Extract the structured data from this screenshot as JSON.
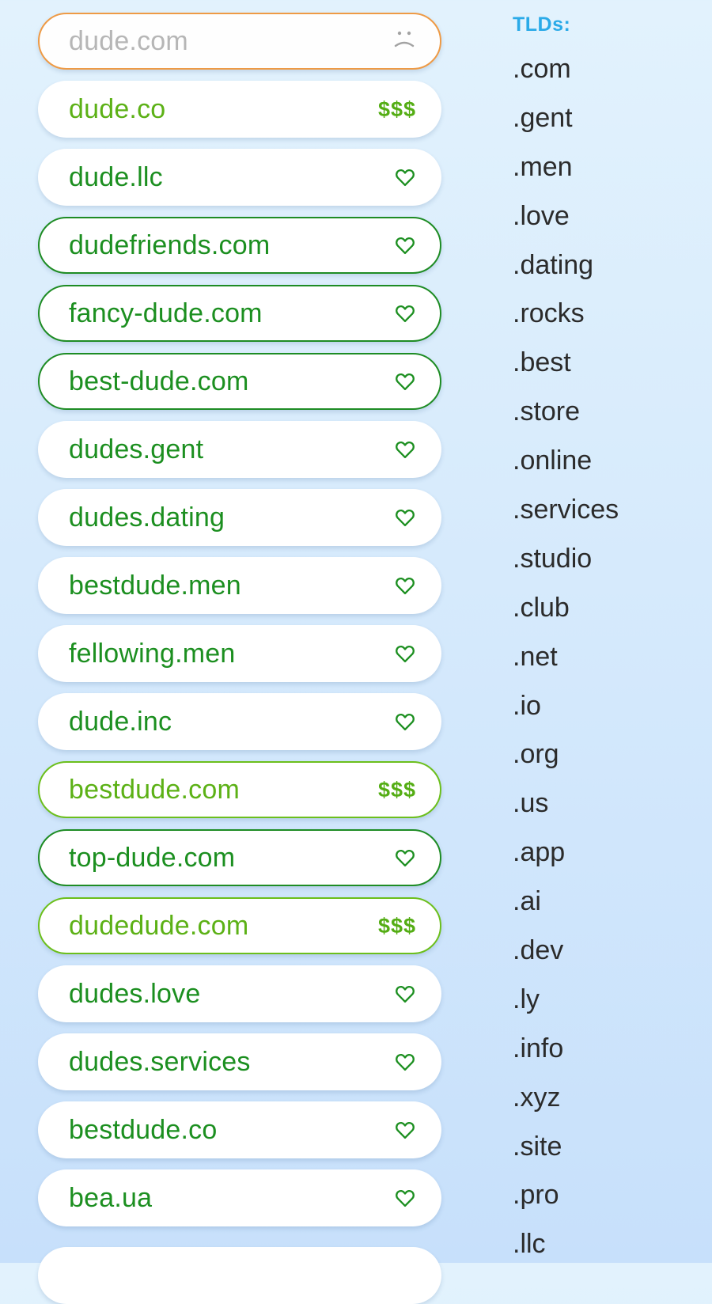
{
  "domains": [
    {
      "name": "dude.com",
      "status": "taken",
      "indicator": "˙͡˙",
      "style": "outlined-orange",
      "tone": "gray"
    },
    {
      "name": "dude.co",
      "status": "premium",
      "indicator": "$$$",
      "style": "plain",
      "tone": "light"
    },
    {
      "name": "dude.llc",
      "status": "available",
      "indicator": "heart",
      "style": "plain",
      "tone": "dark"
    },
    {
      "name": "dudefriends.com",
      "status": "available",
      "indicator": "heart",
      "style": "outlined-dark",
      "tone": "dark"
    },
    {
      "name": "fancy-dude.com",
      "status": "available",
      "indicator": "heart",
      "style": "outlined-dark",
      "tone": "dark"
    },
    {
      "name": "best-dude.com",
      "status": "available",
      "indicator": "heart",
      "style": "outlined-dark",
      "tone": "dark"
    },
    {
      "name": "dudes.gent",
      "status": "available",
      "indicator": "heart",
      "style": "plain",
      "tone": "dark"
    },
    {
      "name": "dudes.dating",
      "status": "available",
      "indicator": "heart",
      "style": "plain",
      "tone": "dark"
    },
    {
      "name": "bestdude.men",
      "status": "available",
      "indicator": "heart",
      "style": "plain",
      "tone": "dark"
    },
    {
      "name": "fellowing.men",
      "status": "available",
      "indicator": "heart",
      "style": "plain",
      "tone": "dark"
    },
    {
      "name": "dude.inc",
      "status": "available",
      "indicator": "heart",
      "style": "plain",
      "tone": "dark"
    },
    {
      "name": "bestdude.com",
      "status": "premium",
      "indicator": "$$$",
      "style": "outlined-light",
      "tone": "light"
    },
    {
      "name": "top-dude.com",
      "status": "available",
      "indicator": "heart",
      "style": "outlined-dark",
      "tone": "dark"
    },
    {
      "name": "dudedude.com",
      "status": "premium",
      "indicator": "$$$",
      "style": "outlined-light",
      "tone": "light"
    },
    {
      "name": "dudes.love",
      "status": "available",
      "indicator": "heart",
      "style": "plain",
      "tone": "dark"
    },
    {
      "name": "dudes.services",
      "status": "available",
      "indicator": "heart",
      "style": "plain",
      "tone": "dark"
    },
    {
      "name": "bestdude.co",
      "status": "available",
      "indicator": "heart",
      "style": "plain",
      "tone": "dark"
    },
    {
      "name": "bea.ua",
      "status": "available",
      "indicator": "heart",
      "style": "plain",
      "tone": "dark"
    }
  ],
  "tld_panel": {
    "heading": "TLDs:",
    "items": [
      ".com",
      ".gent",
      ".men",
      ".love",
      ".dating",
      ".rocks",
      ".best",
      ".store",
      ".online",
      ".services",
      ".studio",
      ".club",
      ".net",
      ".io",
      ".org",
      ".us",
      ".app",
      ".ai",
      ".dev",
      ".ly",
      ".info",
      ".xyz",
      ".site",
      ".pro",
      ".llc"
    ]
  },
  "colors": {
    "available_green": "#1c8f20",
    "premium_green": "#5cb116",
    "taken_gray": "#b6b6b6",
    "taken_border": "#ee9a45",
    "tld_heading": "#2aaae8"
  }
}
